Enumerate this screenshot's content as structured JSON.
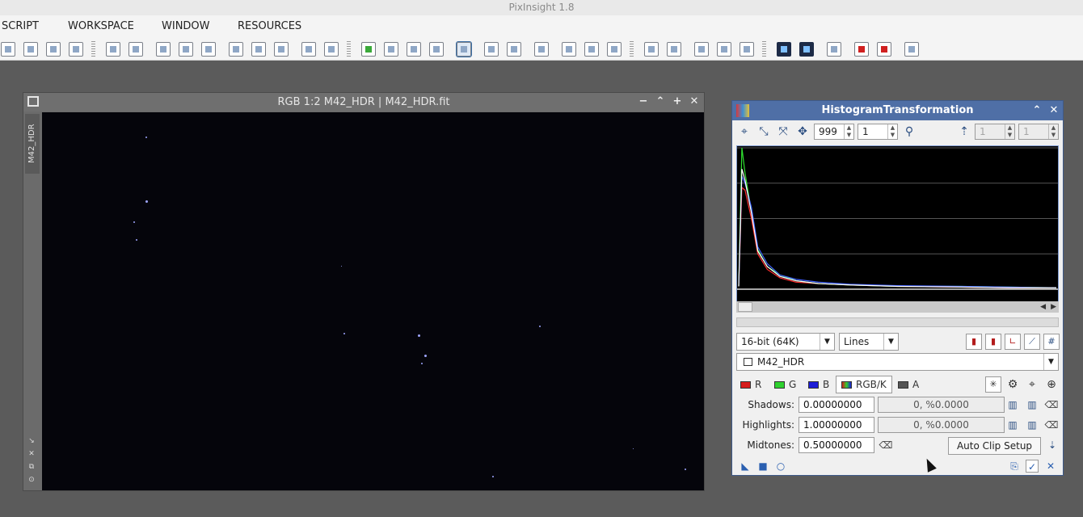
{
  "app": {
    "title": "PixInsight 1.8"
  },
  "menubar": {
    "items": [
      "SCRIPT",
      "WORKSPACE",
      "WINDOW",
      "RESOURCES"
    ]
  },
  "toolbar": {
    "icons": [
      "move-icon",
      "new-window-icon",
      "duplicate-icon",
      "pointer-icon",
      "zoom-in-icon",
      "zoom-out-icon",
      "zoom-fit-icon",
      "zoom-1-1-icon",
      "zoom-2-1-icon",
      "fit-view-icon",
      "fit-selection-icon",
      "window-icon",
      "full-screen-icon",
      "new-process-icon",
      "edit-process-icon",
      "process-a-icon",
      "process-b-icon",
      "preview-icon",
      "download-icon",
      "upload-icon",
      "undo-icon",
      "gear-icon",
      "gear-b-icon",
      "gear-c-icon",
      "panel-icon",
      "panel-close-icon",
      "doc-a-icon",
      "doc-b-icon",
      "doc-c-icon",
      "screen-icon",
      "screen-24-icon",
      "swap-icon",
      "close-all-icon",
      "close-b-icon",
      "plugin-icon"
    ]
  },
  "image_window": {
    "title": "RGB 1:2 M42_HDR | M42_HDR.fit",
    "side_tab": "M42_HDR",
    "controls": {
      "minimize": "−",
      "shade": "⌃",
      "maximize": "+",
      "close": "✕"
    }
  },
  "histogram": {
    "title": "HistogramTransformation",
    "zoom_h": "999",
    "zoom_v": "1",
    "zoom_h2": "1",
    "zoom_v2": "1",
    "resolution": "16-bit (64K)",
    "graph_style": "Lines",
    "view": "M42_HDR",
    "channels": [
      {
        "label": "R",
        "color": "#d61c1c"
      },
      {
        "label": "G",
        "color": "#2ed12e"
      },
      {
        "label": "B",
        "color": "#1c1cd6"
      },
      {
        "label": "RGB/K",
        "color": "#5b5b5b"
      },
      {
        "label": "A",
        "color": "#555555"
      }
    ],
    "active_channel": "RGB/K",
    "shadows": {
      "label": "Shadows:",
      "value": "0.00000000",
      "stat": "0, %0.0000"
    },
    "highlights": {
      "label": "Highlights:",
      "value": "1.00000000",
      "stat": "0, %0.0000"
    },
    "midtones": {
      "label": "Midtones:",
      "value": "0.50000000"
    },
    "auto_clip": "Auto Clip Setup"
  },
  "chart_data": {
    "type": "line",
    "x": [
      0.0,
      0.01,
      0.02,
      0.04,
      0.06,
      0.09,
      0.13,
      0.18,
      0.25,
      0.35,
      0.5,
      0.7,
      0.85,
      1.0
    ],
    "series": [
      {
        "color": "#ff3030",
        "values": [
          2,
          72,
          70,
          50,
          25,
          14,
          8,
          5,
          4,
          3,
          2,
          1.5,
          1,
          1
        ]
      },
      {
        "color": "#30e030",
        "values": [
          2,
          100,
          82,
          55,
          28,
          16,
          10,
          6,
          4,
          3,
          2,
          2,
          1.5,
          1
        ]
      },
      {
        "color": "#4060ff",
        "values": [
          2,
          80,
          75,
          58,
          30,
          18,
          10,
          7,
          5,
          3.5,
          2.5,
          2,
          1.5,
          1
        ]
      },
      {
        "color": "#ffffff",
        "values": [
          2,
          85,
          77,
          54,
          27,
          16,
          9,
          6,
          4,
          3,
          2,
          1.5,
          1,
          1
        ]
      }
    ],
    "xlim": [
      0,
      1
    ],
    "ylim": [
      0,
      100
    ],
    "grid": true
  }
}
